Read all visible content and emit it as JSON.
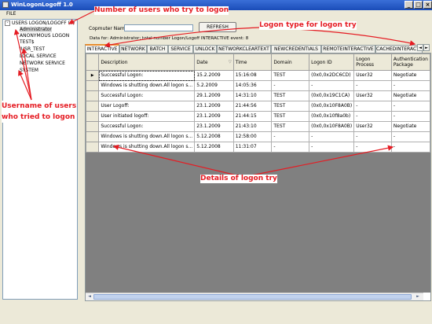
{
  "window": {
    "title": "WinLogonLogoff 1.0",
    "buttons": [
      "_",
      "□",
      "×"
    ]
  },
  "menu": {
    "file": "FILE"
  },
  "tree": {
    "root_label": "USERS LOGON/LOGOFF (7)",
    "expander": "-",
    "items": [
      "Administrator",
      "ANONYMOUS LOGON",
      "TEST$",
      "IUSR_TEST",
      "LOCAL SERVICE",
      "NETWORK SERVICE",
      "SYSTEM"
    ]
  },
  "toolbar": {
    "computer_name_label": "Copmuter Name :",
    "computer_name_value": "",
    "refresh_label": "REFRESH"
  },
  "data_info": "Data for: Administrator; total number Logon/Logoff INTERACTIVE event: 8",
  "tabs": [
    "INTERACTIVE",
    "NETWORK",
    "BATCH",
    "SERVICE",
    "UNLOCK",
    "NETWORKCLEARTEXT",
    "NEWCREDENTIALS",
    "REMOTEINTERACTIVE",
    "CACHEDINTERACTIVE"
  ],
  "tab_arrows": [
    "◄",
    "►"
  ],
  "grid": {
    "columns": [
      "Description",
      "Date",
      "Time",
      "Domain",
      "Logon ID",
      "Logon Process",
      "Authentication Package"
    ],
    "sort_glyph": "▽",
    "current_row_marker": "▶",
    "rows": [
      [
        "Successful Logon:",
        "15.2.2009",
        "15:16:08",
        "TEST",
        "(0x0,0x2DC6CD)",
        "User32",
        "Negotiate"
      ],
      [
        "Windows is shutting down.All logon s...",
        "5.2.2009",
        "14:05:36",
        "-",
        "-",
        "-",
        "-"
      ],
      [
        "Successful Logon:",
        "29.1.2009",
        "14:31:10",
        "TEST",
        "(0x0,0x19C1CA)",
        "User32",
        "Negotiate"
      ],
      [
        "User Logoff:",
        "23.1.2009",
        "21:44:56",
        "TEST",
        "(0x0,0x10F8A0B)",
        "-",
        "-"
      ],
      [
        "User initiated logoff:",
        "23.1.2009",
        "21:44:15",
        "TEST",
        "(0x0,0x10f8a0b)",
        "-",
        "-"
      ],
      [
        "Successful Logon:",
        "23.1.2009",
        "21:43:10",
        "TEST",
        "(0x0,0x10F8A0B)",
        "User32",
        "Negotiate"
      ],
      [
        "Windows is shutting down.All logon s...",
        "5.12.2008",
        "12:58:00",
        "-",
        "-",
        "-",
        "-"
      ],
      [
        "Windows is shutting down.All logon s...",
        "5.12.2008",
        "11:31:07",
        "-",
        "-",
        "-",
        "-"
      ]
    ]
  },
  "scrollbar": {
    "left_arrow": "◄",
    "right_arrow": "►"
  },
  "annotations": {
    "users_count": "Number of users who try to logon",
    "logon_type": "Logon type for logon try",
    "username": "Username of users who tried to logon",
    "details": "Details of logon try"
  },
  "colors": {
    "annotation": "#e51c23",
    "titlebar": "#2a5cc8",
    "active_tab_accent": "#e68b2c"
  }
}
